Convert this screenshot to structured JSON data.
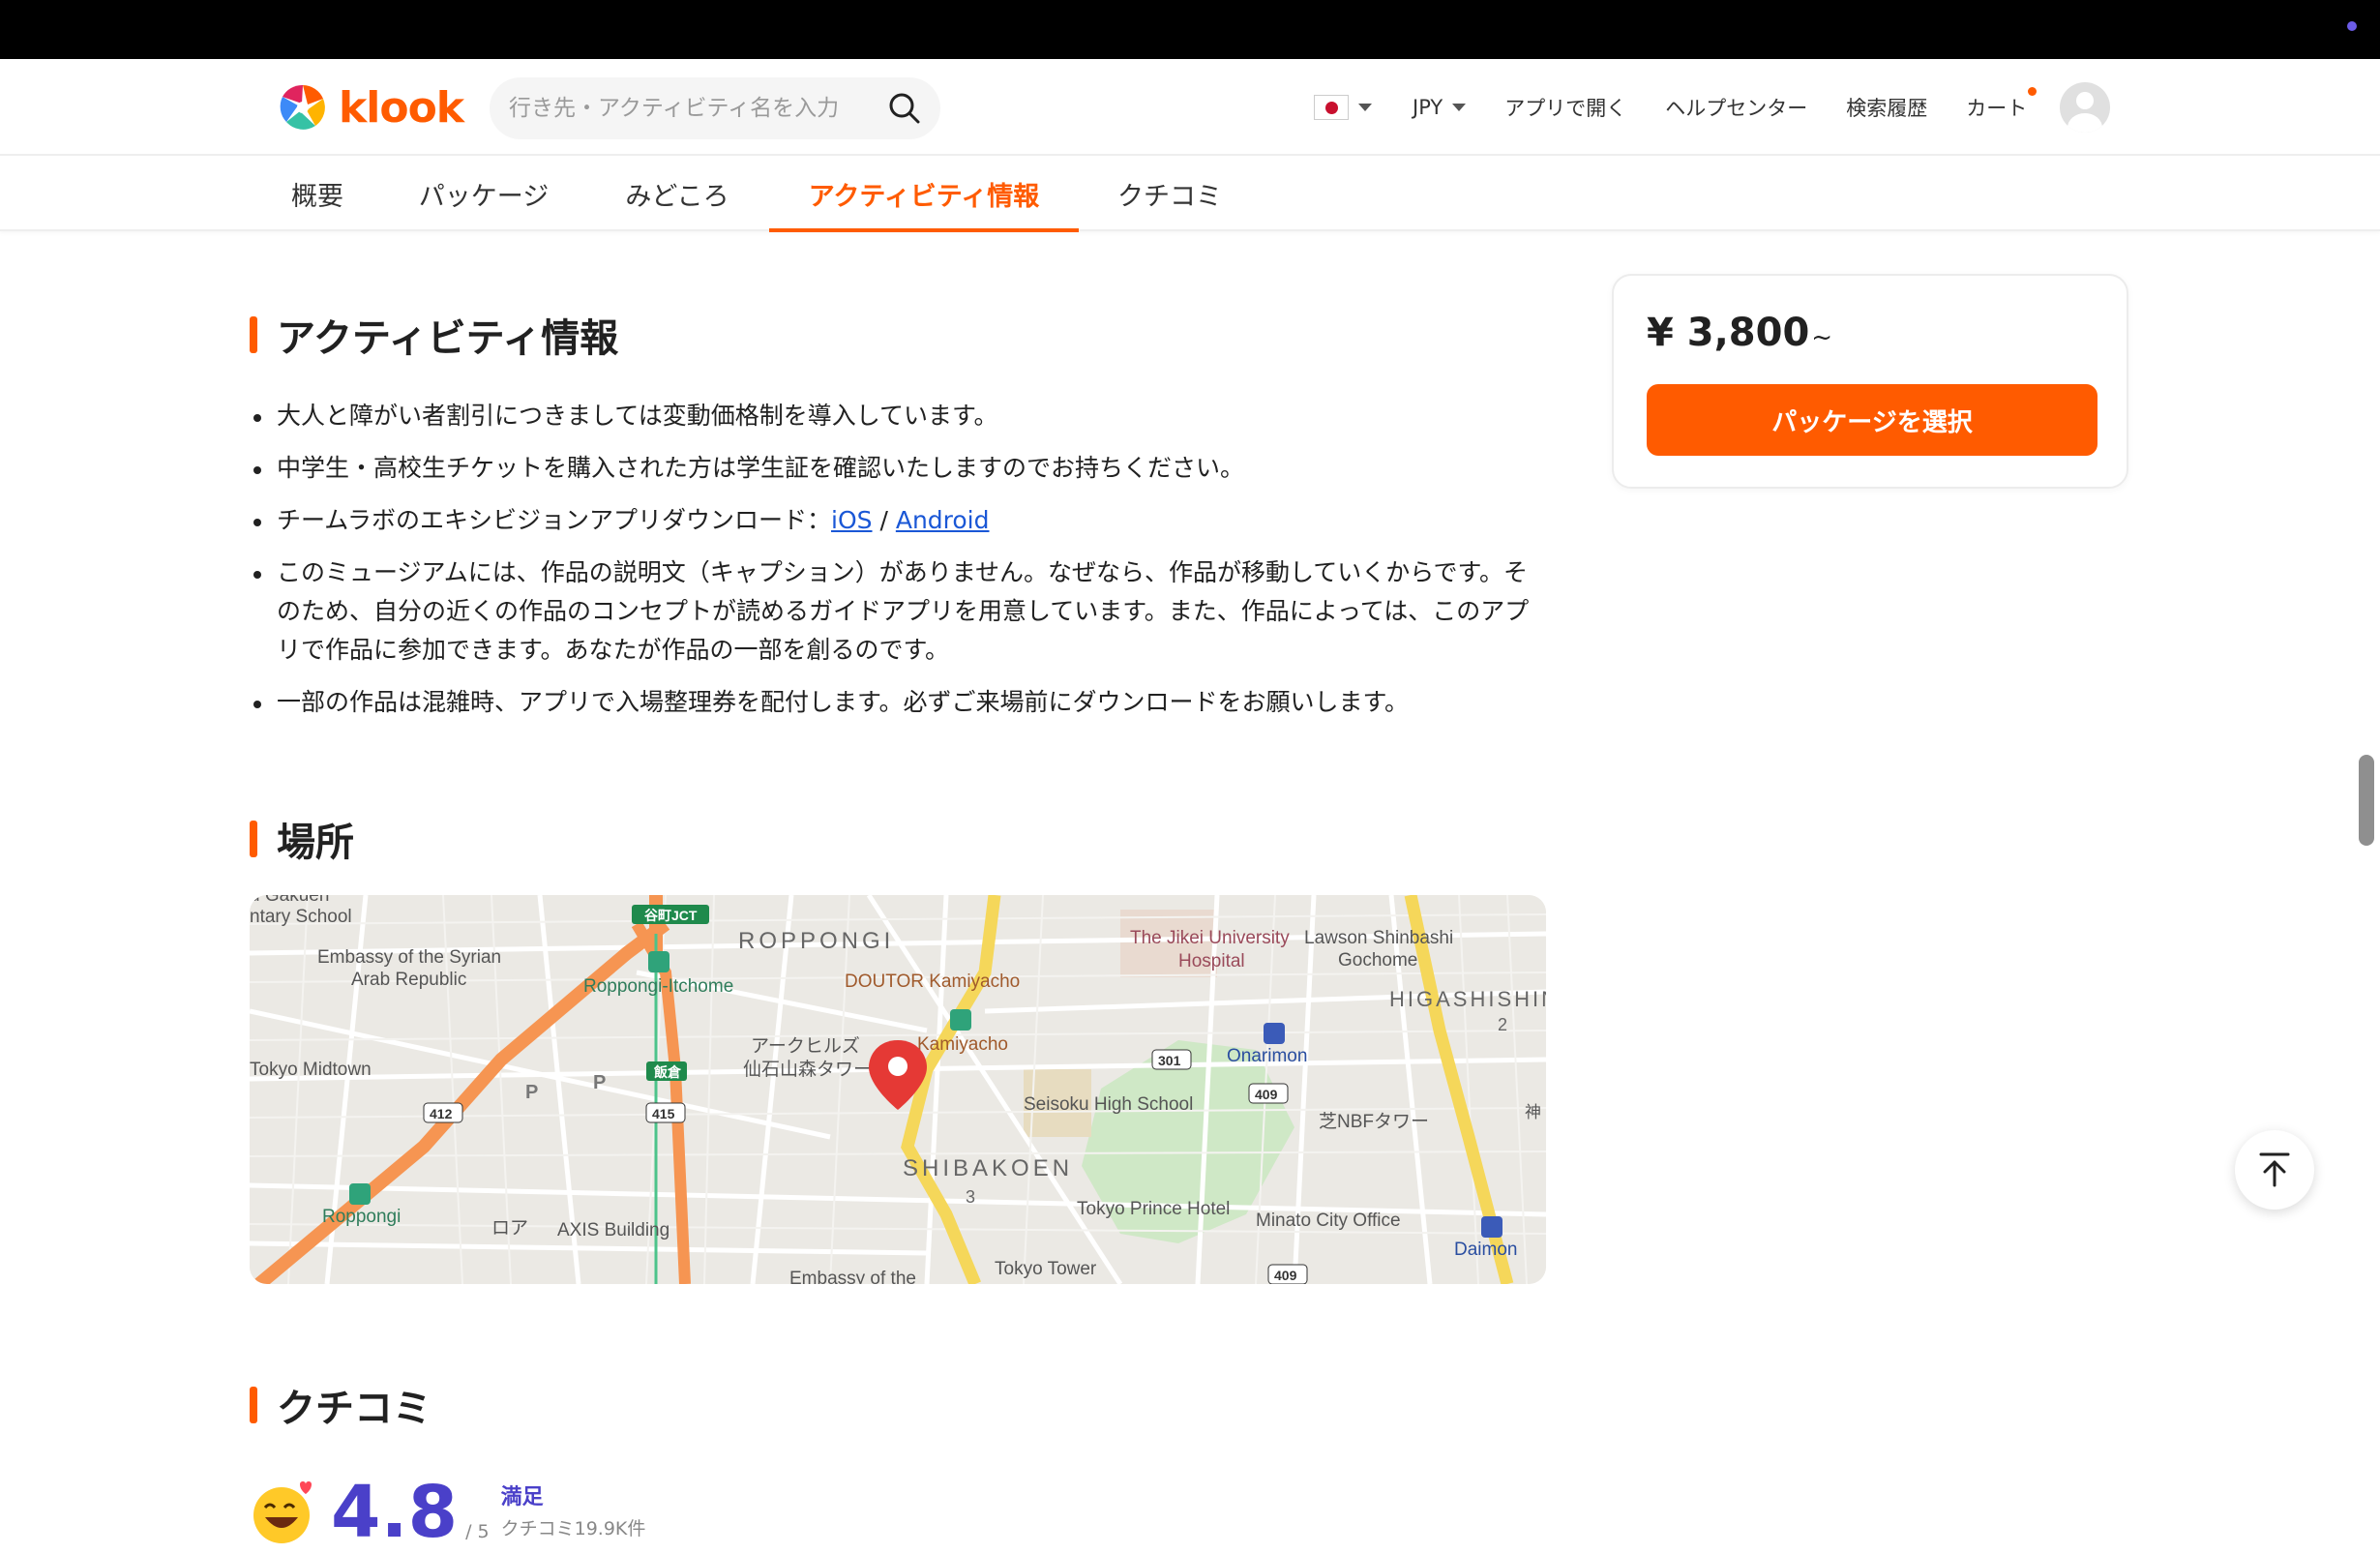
{
  "brand": {
    "name": "klook",
    "accent": "#ff5b00",
    "rating_color": "#4a40c9"
  },
  "header": {
    "search_placeholder": "行き先・アクティビティ名を入力",
    "flag_icon": "japan-flag-icon",
    "currency": "JPY",
    "links": {
      "open_app": "アプリで開く",
      "help": "ヘルプセンター",
      "history": "検索履歴",
      "cart": "カート"
    }
  },
  "tabs": [
    {
      "label": "概要"
    },
    {
      "label": "パッケージ"
    },
    {
      "label": "みどころ"
    },
    {
      "label": "アクティビティ情報",
      "active": true
    },
    {
      "label": "クチコミ"
    }
  ],
  "activity_info": {
    "title": "アクティビティ情報",
    "items": [
      "大人と障がい者割引につきましては変動価格制を導入しています。",
      "中学生・高校生チケットを購入された方は学生証を確認いたしますのでお持ちください。",
      "このミュージアムには、作品の説明文（キャプション）がありません。なぜなら、作品が移動していくからです。そのため、自分の近くの作品のコンセプトが読めるガイドアプリを用意しています。また、作品によっては、このアプリで作品に参加できます。あなたが作品の一部を創るのです。",
      "一部の作品は混雑時、アプリで入場整理券を配付します。必ずご来場前にダウンロードをお願いします。"
    ],
    "app_item": {
      "text": "チームラボのエキシビジョンアプリダウンロード：",
      "ios": "iOS",
      "separator": " / ",
      "android": "Android"
    }
  },
  "location": {
    "title": "場所",
    "map_labels": {
      "roppongi": "ROPPONGI",
      "shibakoen": "SHIBAKOEN",
      "shibakoen_num": "3",
      "higashishin": "HIGASHISHIN",
      "higashishin_num": "2",
      "ark_hills": "アークヒルズ",
      "sengoku": "仙石山森タワー",
      "kamiyacho": "Kamiyacho",
      "doutor": "DOUTOR Kamiyacho",
      "roppongi_1": "Roppongi-Itchome",
      "embassy_syria_1": "Embassy of the Syrian",
      "embassy_syria_2": "Arab Republic",
      "tokyo_midtown": "Tokyo Midtown",
      "roppongi_st": "Roppongi",
      "axis": "AXIS Building",
      "roa": "ロア",
      "seisoku": "Seisoku High School",
      "prince": "Tokyo Prince Hotel",
      "tower": "Tokyo Tower",
      "minato": "Minato City Office",
      "daimon": "Daimon",
      "onarimon": "Onarimon",
      "nbf": "芝NBFタワー",
      "jikei_1": "The Jikei University",
      "jikei_2": "Hospital",
      "lawson_1": "Lawson Shinbashi",
      "lawson_2": "Gochome",
      "tary": "ntary School",
      "gakuen": "u Gakuen",
      "embassy_bottom": "Embassy of the",
      "jct": "谷町JCT",
      "iikura": "飯倉",
      "kami": "神",
      "r412": "412",
      "r415": "415",
      "r301": "301",
      "r409a": "409",
      "r409b": "409",
      "p1": "P",
      "p2": "P"
    }
  },
  "reviews": {
    "title": "クチコミ",
    "score": "4.8",
    "out_of": "/ 5",
    "label": "満足",
    "count": "クチコミ19.9K件"
  },
  "price_card": {
    "price": "¥ 3,800",
    "suffix": "~",
    "button": "パッケージを選択"
  }
}
